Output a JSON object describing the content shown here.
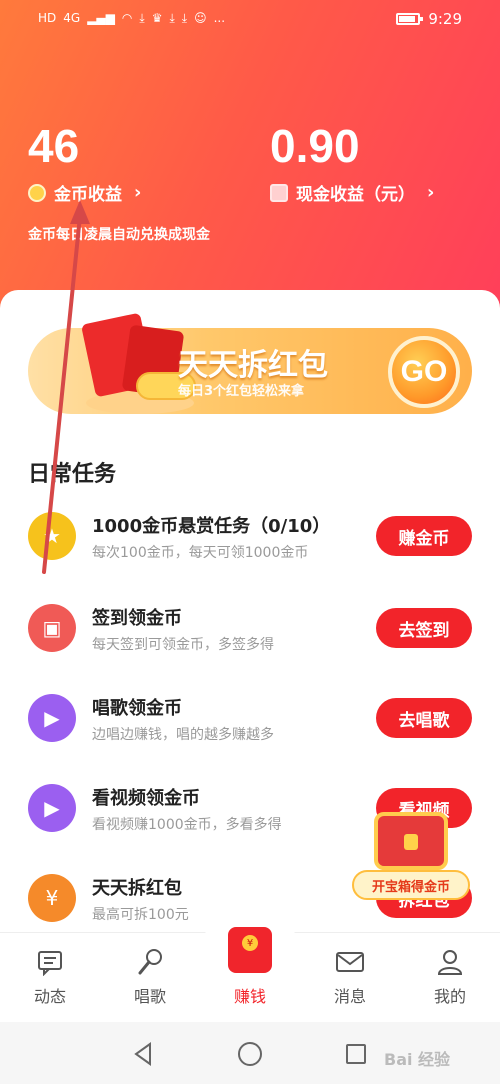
{
  "status_bar": {
    "left_icons": [
      "HD",
      "4G",
      "signal",
      "wifi",
      "download",
      "app",
      "download",
      "download",
      "app",
      "..."
    ],
    "time": "9:29",
    "battery_level": 0.85
  },
  "earnings": {
    "coins": {
      "value": "46",
      "label": "金币收益",
      "chevron": "›"
    },
    "cash": {
      "value": "0.90",
      "label": "现金收益（元）",
      "chevron": "›"
    },
    "note": "金币每日凌晨自动兑换成现金"
  },
  "banner": {
    "title": "天天拆红包",
    "subtitle": "每日3个红包轻松来拿",
    "go_label": "GO"
  },
  "daily_tasks": {
    "title": "日常任务",
    "items": [
      {
        "title": "1000金币悬赏任务（0/10）",
        "desc": "每次100金币，每天可领1000金币",
        "button": "赚金币",
        "icon": "reward-icon",
        "icon_color": "#f6c21c"
      },
      {
        "title": "签到领金币",
        "desc": "每天签到可领金币，多签多得",
        "button": "去签到",
        "icon": "calendar-icon",
        "icon_color": "#f05a56"
      },
      {
        "title": "唱歌领金币",
        "desc": "边唱边赚钱，唱的越多赚越多",
        "button": "去唱歌",
        "icon": "play-icon",
        "icon_color": "#9b5ff0"
      },
      {
        "title": "看视频领金币",
        "desc": "看视频赚1000金币，多看多得",
        "button": "看视频",
        "icon": "play-icon",
        "icon_color": "#9b5ff0"
      },
      {
        "title": "天天拆红包",
        "desc": "最高可拆100元",
        "button": "拆红包",
        "icon": "coin-jar-icon",
        "icon_color": "#f58a2a"
      }
    ]
  },
  "treasure": {
    "label": "开宝箱得金币"
  },
  "tabs": [
    {
      "label": "动态",
      "icon": "chat-icon"
    },
    {
      "label": "唱歌",
      "icon": "microphone-icon"
    },
    {
      "label": "赚钱",
      "icon": "red-packet-icon"
    },
    {
      "label": "消息",
      "icon": "mail-icon"
    },
    {
      "label": "我的",
      "icon": "person-icon"
    }
  ],
  "nav": {
    "watermark": "Bai 经验"
  },
  "colors": {
    "accent": "#f2242a",
    "header_start": "#ff7a3c",
    "header_end": "#ff3f5a"
  }
}
